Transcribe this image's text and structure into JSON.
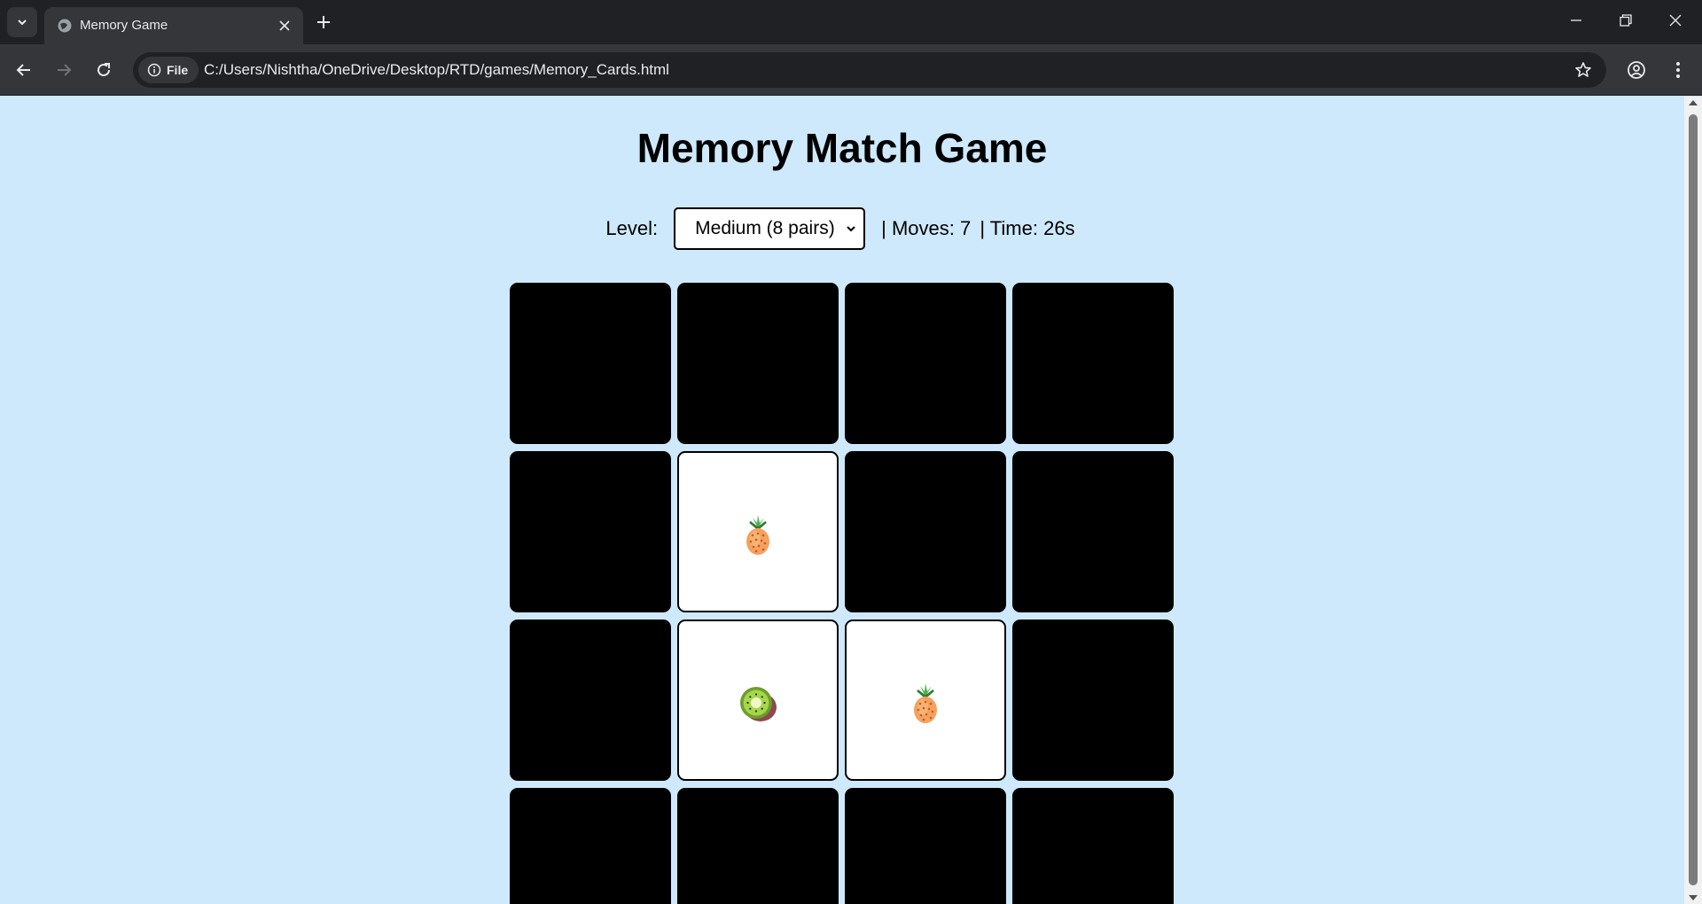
{
  "browser": {
    "tab_title": "Memory Game",
    "site_chip": "File",
    "url": "C:/Users/Nishtha/OneDrive/Desktop/RTD/games/Memory_Cards.html"
  },
  "page": {
    "title": "Memory Match Game",
    "level_label": "Level:",
    "level_selected": "Medium (8 pairs)",
    "moves_text": "| Moves: 7",
    "time_text": "| Time: 26s"
  },
  "cards": [
    {
      "state": "hidden",
      "emoji": ""
    },
    {
      "state": "hidden",
      "emoji": ""
    },
    {
      "state": "hidden",
      "emoji": ""
    },
    {
      "state": "hidden",
      "emoji": ""
    },
    {
      "state": "hidden",
      "emoji": ""
    },
    {
      "state": "open",
      "emoji": "pineapple"
    },
    {
      "state": "hidden",
      "emoji": ""
    },
    {
      "state": "hidden",
      "emoji": ""
    },
    {
      "state": "hidden",
      "emoji": ""
    },
    {
      "state": "open",
      "emoji": "kiwi"
    },
    {
      "state": "open",
      "emoji": "pineapple"
    },
    {
      "state": "hidden",
      "emoji": ""
    },
    {
      "state": "hidden",
      "emoji": ""
    },
    {
      "state": "hidden",
      "emoji": ""
    },
    {
      "state": "hidden",
      "emoji": ""
    },
    {
      "state": "hidden",
      "emoji": ""
    }
  ],
  "colors": {
    "page_background": "#cfe9fc",
    "card_back": "#000000",
    "card_face": "#ffffff"
  }
}
